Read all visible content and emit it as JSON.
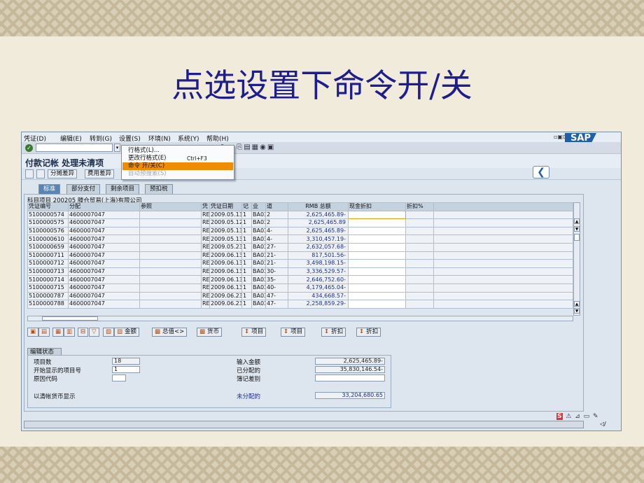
{
  "slide_title": "点选设置下命令开/关",
  "menu": {
    "items": [
      "凭证(D)",
      "编辑(E)",
      "转到(G)",
      "设置(S)",
      "环境(N)",
      "系统(Y)",
      "帮助(H)"
    ],
    "window_controls": "▫▣⊡",
    "logo": "SAP"
  },
  "toolbar": {
    "command_field_value": "",
    "ok_icon": "✓"
  },
  "title": "付款记帐 处理未清项",
  "toolbar2": {
    "buttons": [
      "分摊差异",
      "费用差异"
    ],
    "tail_label": "期"
  },
  "settings_menu": {
    "items": [
      {
        "label": "行格式(L)...",
        "shortcut": "",
        "state": "normal"
      },
      {
        "label": "更改行格式(E)",
        "shortcut": "Ctrl+F3",
        "state": "normal"
      },
      {
        "label": "命令 开/关(C)",
        "shortcut": "",
        "state": "active"
      },
      {
        "label": "自动预搜索(S)",
        "shortcut": "",
        "state": "disabled"
      }
    ]
  },
  "tabs": [
    "标准",
    "部分支付",
    "剩余项目",
    "预扣税"
  ],
  "grid": {
    "caption": "科目项目 200205 滕仓贸易(上海)有限公司",
    "columns": [
      "凭证编号",
      "分配",
      "参照",
      "凭",
      "凭证日期",
      "记",
      "业",
      "道",
      "RMB 总额",
      "现金折扣",
      "折扣%"
    ],
    "rows": [
      [
        "5100000574",
        "4600007047",
        "",
        "RE",
        "2009.05.13",
        "1",
        "BA03",
        "2",
        "2,625,465.89-",
        "",
        ""
      ],
      [
        "5100000575",
        "4600007047",
        "",
        "RE",
        "2009.05.12",
        "1",
        "BA03",
        "2",
        "2,625,465.89",
        "",
        ""
      ],
      [
        "5100000576",
        "4600007047",
        "",
        "RE",
        "2009.05.13",
        "1",
        "BA03",
        "4-",
        "2,625,465.89-",
        "",
        ""
      ],
      [
        "5100000610",
        "4600007047",
        "",
        "RE",
        "2009.05.13",
        "1",
        "BA03",
        "4-",
        "3,310,457.19-",
        "",
        ""
      ],
      [
        "5100000659",
        "4600007047",
        "",
        "RE",
        "2009.05.23",
        "1",
        "BA03",
        "27-",
        "2,632,057.68-",
        "",
        ""
      ],
      [
        "5100000711",
        "4600007047",
        "",
        "RE",
        "2009.06.13",
        "1",
        "BA03",
        "21-",
        "817,501.56-",
        "",
        ""
      ],
      [
        "5100000712",
        "4600007047",
        "",
        "RE",
        "2009.06.13",
        "1",
        "BA03",
        "21-",
        "3,498,198.15-",
        "",
        ""
      ],
      [
        "5100000713",
        "4600007047",
        "",
        "RE",
        "2009.06.13",
        "1",
        "BA03",
        "30-",
        "3,336,529.57-",
        "",
        ""
      ],
      [
        "5100000714",
        "4600007047",
        "",
        "RE",
        "2009.06.13",
        "1",
        "BA03",
        "35-",
        "2,646,752.60-",
        "",
        ""
      ],
      [
        "5100000715",
        "4600007047",
        "",
        "RE",
        "2009.06.13",
        "1",
        "BA03",
        "40-",
        "4,179,465.04-",
        "",
        ""
      ],
      [
        "5100000787",
        "4600007047",
        "",
        "RE",
        "2009.06.23",
        "1",
        "BA03",
        "47-",
        "434,668.57-",
        "",
        ""
      ],
      [
        "5100000788",
        "4600007047",
        "",
        "RE",
        "2009.06.23",
        "1",
        "BA03",
        "47-",
        "2,258,859.29-",
        "",
        ""
      ]
    ]
  },
  "action_buttons": [
    "金额",
    "总值<>",
    "货币",
    "项目",
    "项目",
    "折扣",
    "折扣"
  ],
  "status": {
    "tab_label": "编辑状态",
    "items_label": "项目数",
    "items_value": "18",
    "first_item_label": "开始显示的项目号",
    "first_item_value": "1",
    "reason_label": "原因代码",
    "reason_value": "",
    "currency_label": "以清帐货币显示",
    "entered_label": "输入金额",
    "entered_value": "2,625,465.89-",
    "assigned_label": "已分配的",
    "assigned_value": "35,830,146.54-",
    "diff_label": "簿记差别",
    "diff_value": "",
    "unassigned_label": "未分配的",
    "unassigned_value": "33,204,680.65"
  },
  "statusbar": {
    "icons": "S 🔒 ⚠ ⊞ ✎",
    "page": "◁/"
  }
}
